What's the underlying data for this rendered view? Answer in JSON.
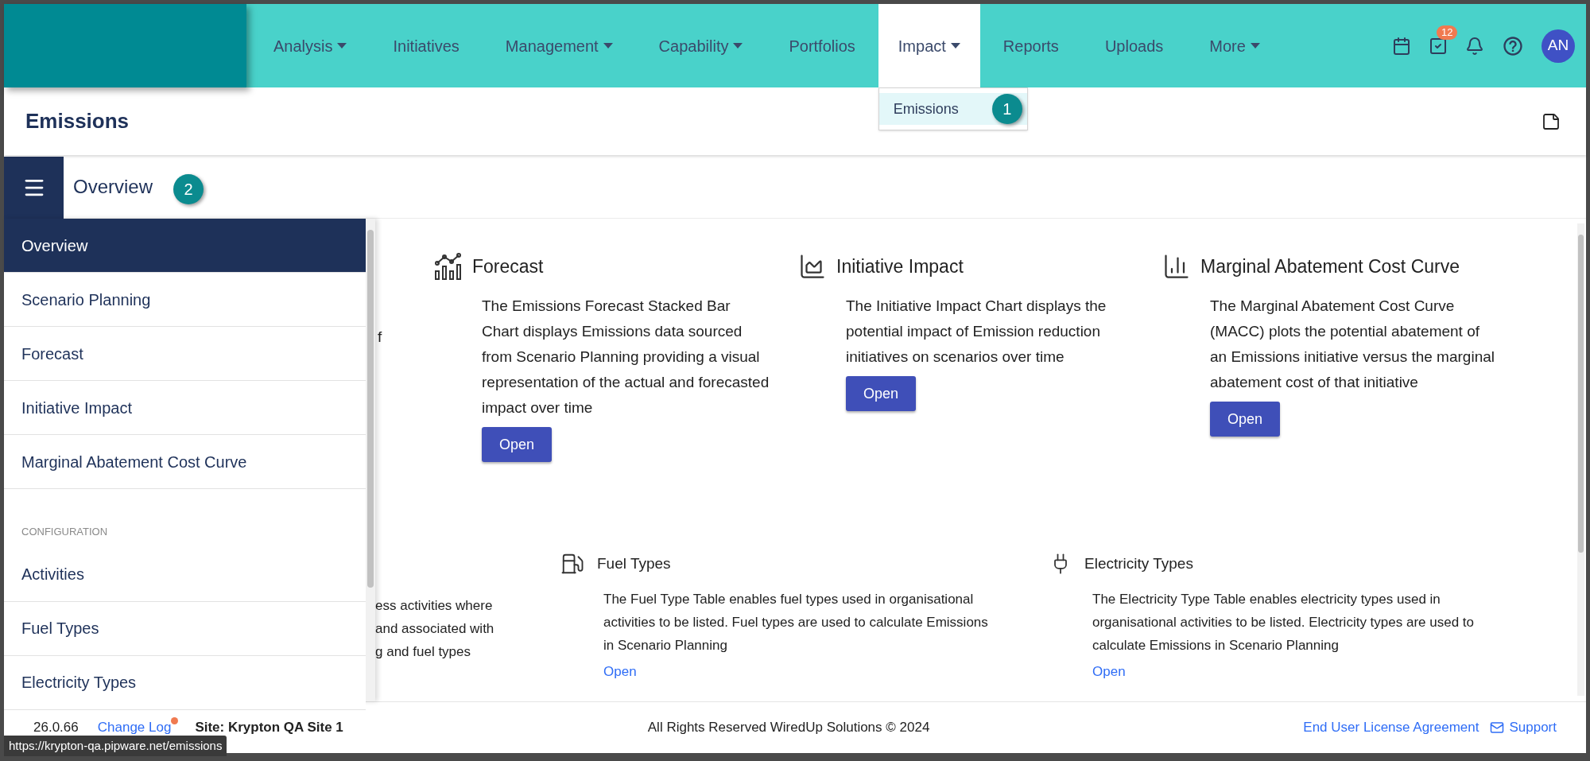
{
  "nav": {
    "items": [
      {
        "label": "Analysis",
        "dropdown": true,
        "selected": false
      },
      {
        "label": "Initiatives",
        "dropdown": false,
        "selected": false
      },
      {
        "label": "Management",
        "dropdown": true,
        "selected": false
      },
      {
        "label": "Capability",
        "dropdown": true,
        "selected": false
      },
      {
        "label": "Portfolios",
        "dropdown": false,
        "selected": false
      },
      {
        "label": "Impact",
        "dropdown": true,
        "selected": true
      },
      {
        "label": "Reports",
        "dropdown": false,
        "selected": false
      },
      {
        "label": "Uploads",
        "dropdown": false,
        "selected": false
      },
      {
        "label": "More",
        "dropdown": true,
        "selected": false
      }
    ],
    "task_badge": "12",
    "avatar": "AN"
  },
  "dropdown": {
    "items": [
      {
        "label": "Emissions",
        "selected": true
      }
    ],
    "callout": "1"
  },
  "page_title": "Emissions",
  "subheader": {
    "title": "Overview",
    "callout": "2"
  },
  "sidebar": {
    "items": [
      {
        "kind": "item",
        "label": "Overview",
        "selected": true
      },
      {
        "kind": "item",
        "label": "Scenario Planning",
        "selected": false
      },
      {
        "kind": "item",
        "label": "Forecast",
        "selected": false
      },
      {
        "kind": "item",
        "label": "Initiative Impact",
        "selected": false
      },
      {
        "kind": "item",
        "label": "Marginal Abatement Cost Curve",
        "selected": false
      },
      {
        "kind": "section",
        "label": "CONFIGURATION"
      },
      {
        "kind": "item",
        "label": "Activities",
        "selected": false
      },
      {
        "kind": "item",
        "label": "Fuel Types",
        "selected": false
      },
      {
        "kind": "item",
        "label": "Electricity Types",
        "selected": false
      }
    ]
  },
  "covered_fragments": {
    "top": [
      "f"
    ],
    "bottom": [
      "ess activities where",
      "and associated with",
      "g and fuel types"
    ]
  },
  "chart_cards": [
    {
      "kind": "forecast",
      "title": "Forecast",
      "description": "The Emissions Forecast Stacked Bar Chart displays Emissions data sourced from Scenario Planning providing a visual representation of the actual and forecasted impact over time",
      "button": "Open"
    },
    {
      "kind": "area",
      "title": "Initiative Impact",
      "description": "The Initiative Impact Chart displays the potential impact of Emission reduction initiatives on scenarios over time",
      "button": "Open"
    },
    {
      "kind": "bars",
      "title": "Marginal Abatement Cost Curve",
      "description": "The Marginal Abatement Cost Curve (MACC) plots the potential abatement of an Emissions initiative versus the marginal abatement cost of that initiative",
      "button": "Open"
    }
  ],
  "table_cards": [
    {
      "kind": "fuel",
      "title": "Fuel Types",
      "description": "The Fuel Type Table enables fuel types used in organisational activities to be listed. Fuel types are used to calculate Emissions in Scenario Planning",
      "link": "Open"
    },
    {
      "kind": "plug",
      "title": "Electricity Types",
      "description": "The Electricity Type Table enables electricity types used in organisational activities to be listed. Electricity types are used to calculate Emissions in Scenario Planning",
      "link": "Open"
    }
  ],
  "footer": {
    "version": "26.0.66",
    "change_log": "Change Log",
    "change_log_new": true,
    "site": "Site: Krypton QA Site 1",
    "copyright": "All Rights Reserved WiredUp Solutions © 2024",
    "eula": "End User License Agreement",
    "support": "Support"
  },
  "status_url": "https://krypton-qa.pipware.net/emissions"
}
